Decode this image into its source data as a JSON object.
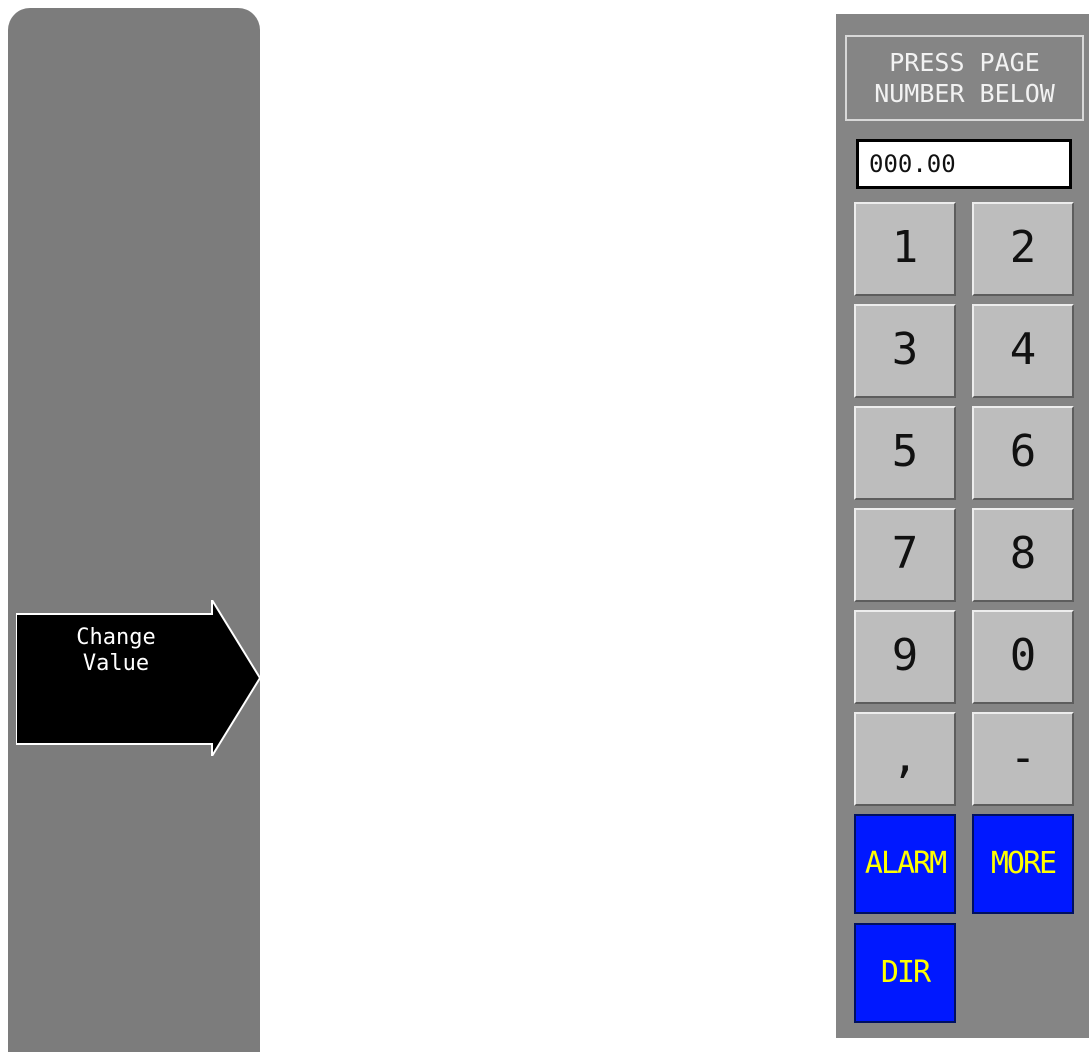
{
  "left_panel": {
    "change_value_button": {
      "label": "Change\nValue"
    }
  },
  "keypad": {
    "prompt": "PRESS PAGE\nNUMBER BELOW",
    "page_input_value": "000.00",
    "keys": [
      "1",
      "2",
      "3",
      "4",
      "5",
      "6",
      "7",
      "8",
      "9",
      "0",
      ",",
      "-"
    ],
    "function_keys": {
      "alarm": "ALARM",
      "more": "MORE",
      "dir": "DIR"
    }
  }
}
